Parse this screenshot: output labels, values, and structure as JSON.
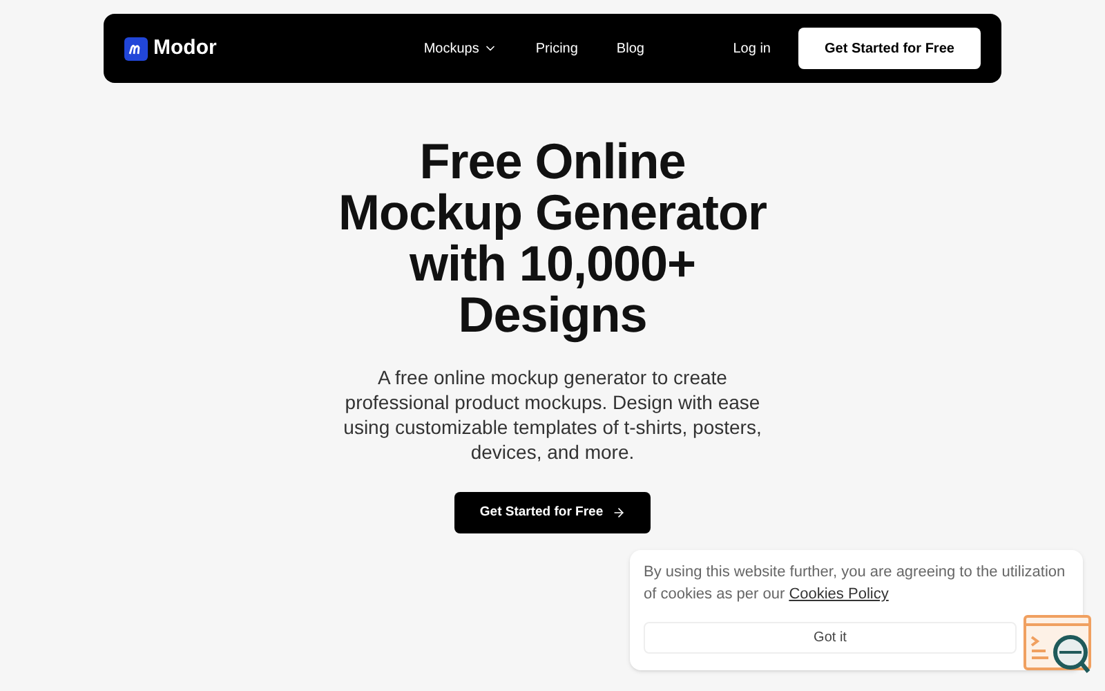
{
  "nav": {
    "brand": "Modor",
    "links": [
      {
        "label": "Mockups",
        "dropdown": true
      },
      {
        "label": "Pricing",
        "dropdown": false
      },
      {
        "label": "Blog",
        "dropdown": false
      }
    ],
    "login": "Log in",
    "cta": "Get Started for Free"
  },
  "hero": {
    "title": "Free Online Mockup Generator with 10,000+ Designs",
    "subtitle": "A free online mockup generator to create professional product mockups. Design with ease using customizable templates of t-shirts, posters, devices, and more.",
    "cta": "Get Started for Free"
  },
  "cookie": {
    "text": "By using this website further, you are agreeing to the utilization of cookies as per our",
    "link": "Cookies Policy",
    "button": "Got it"
  }
}
